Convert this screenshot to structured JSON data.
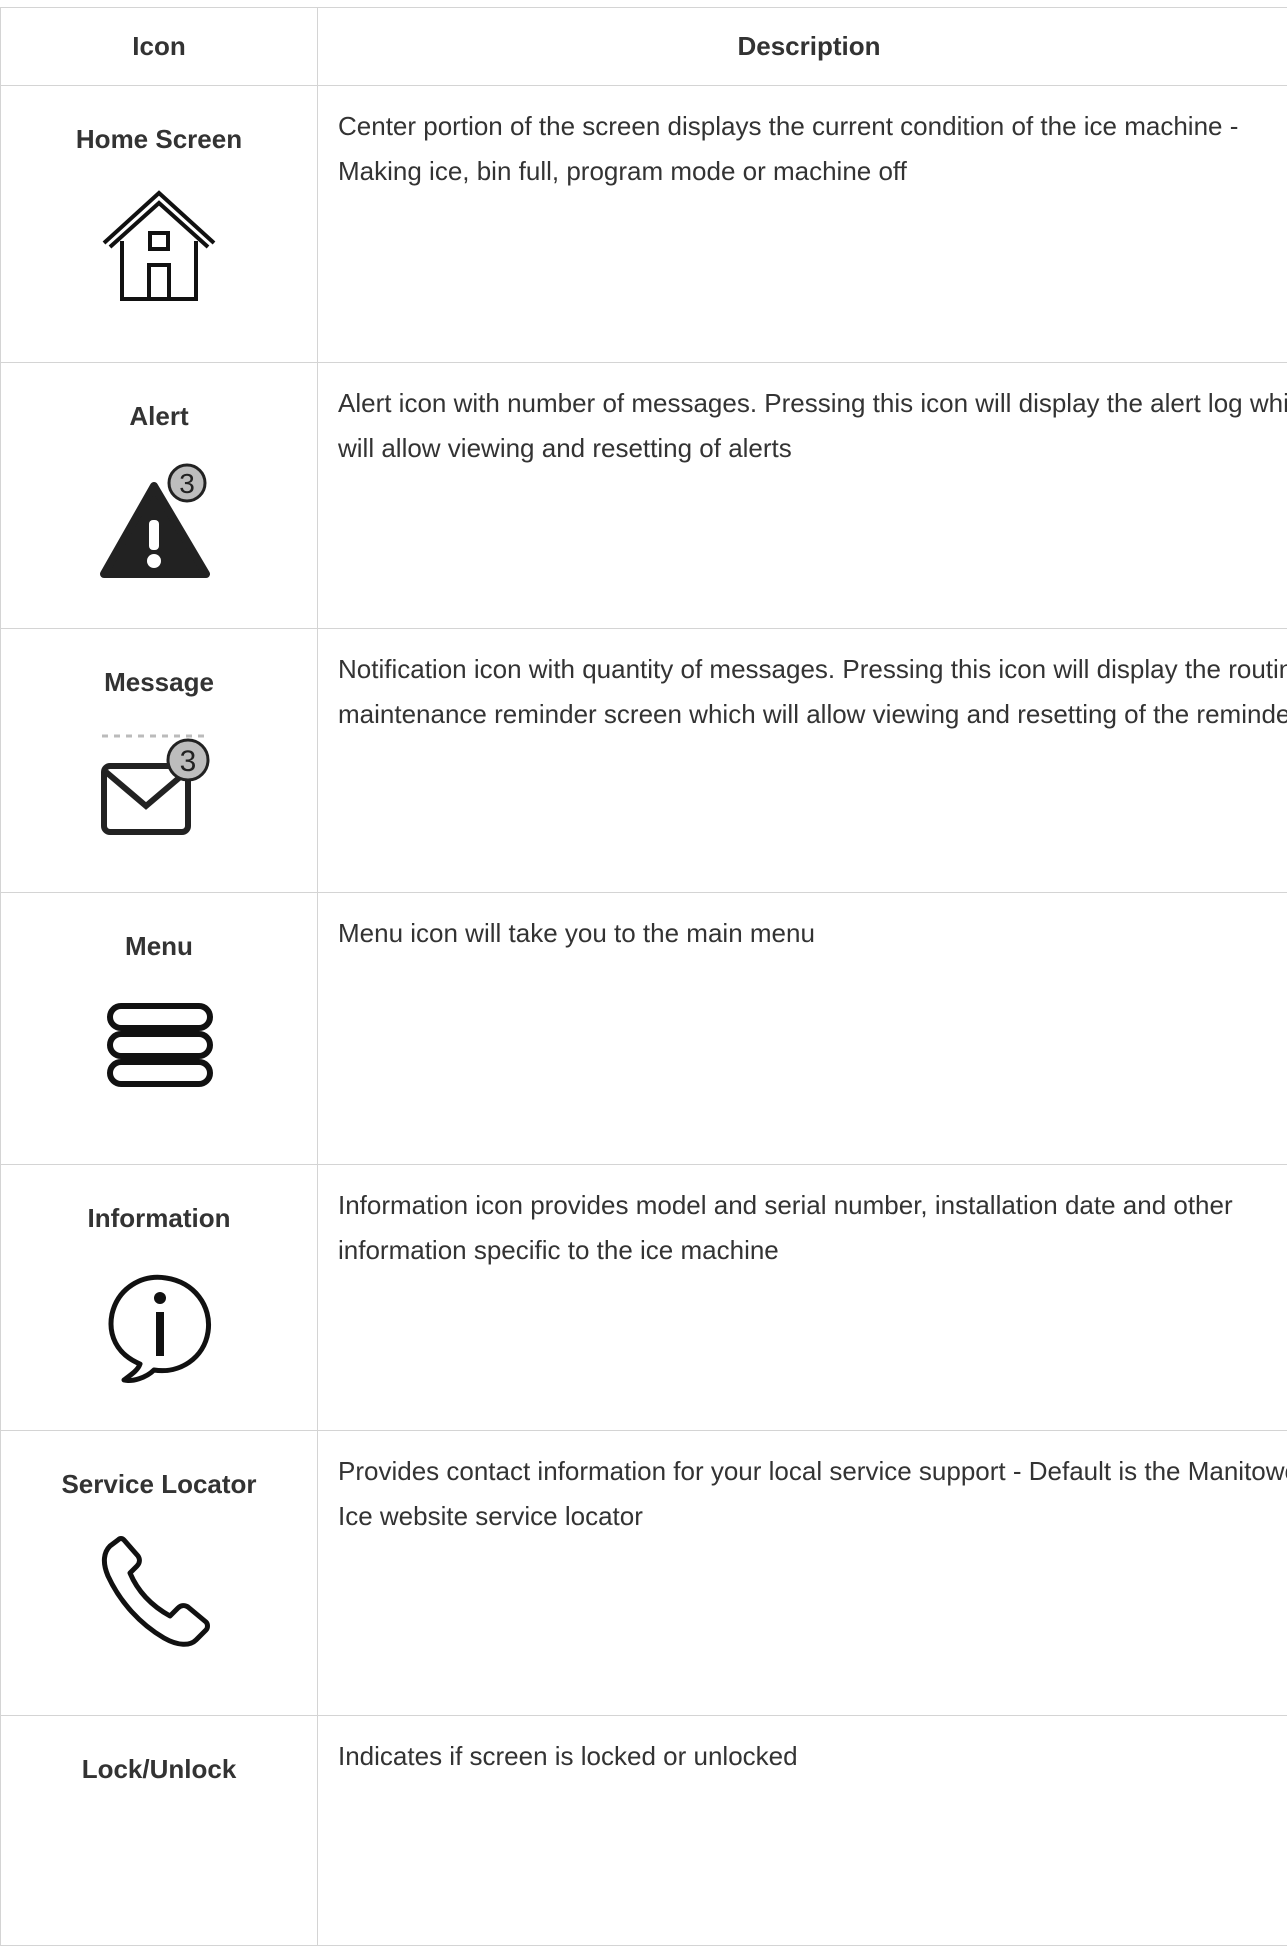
{
  "table": {
    "headers": {
      "icon": "Icon",
      "description": "Description"
    },
    "rows": [
      {
        "name": "Home Screen",
        "icon": "home-icon",
        "description": "Center portion of the screen displays the current condition of the ice machine - Making ice, bin full, program mode or machine off"
      },
      {
        "name": "Alert",
        "icon": "alert-icon",
        "badge": "3",
        "description": "Alert icon with number of messages. Pressing this icon will display the alert log which will allow viewing and resetting of alerts"
      },
      {
        "name": "Message",
        "icon": "message-icon",
        "badge": "3",
        "description": "Notification icon with quantity of messages. Pressing this icon will display the routine maintenance reminder screen which will allow viewing and resetting of the reminder"
      },
      {
        "name": "Menu",
        "icon": "menu-icon",
        "description": "Menu icon will take you to the main menu"
      },
      {
        "name": "Information",
        "icon": "information-icon",
        "description": "Information icon provides model and serial number, installation date and other information specific to the ice machine"
      },
      {
        "name": "Service Locator",
        "icon": "phone-icon",
        "description": "Provides contact information for your local service support - Default is the Manitowoc Ice website service locator"
      },
      {
        "name": "Lock/Unlock",
        "icon": "lock-icon",
        "description": "Indicates if screen is locked or unlocked"
      }
    ]
  }
}
